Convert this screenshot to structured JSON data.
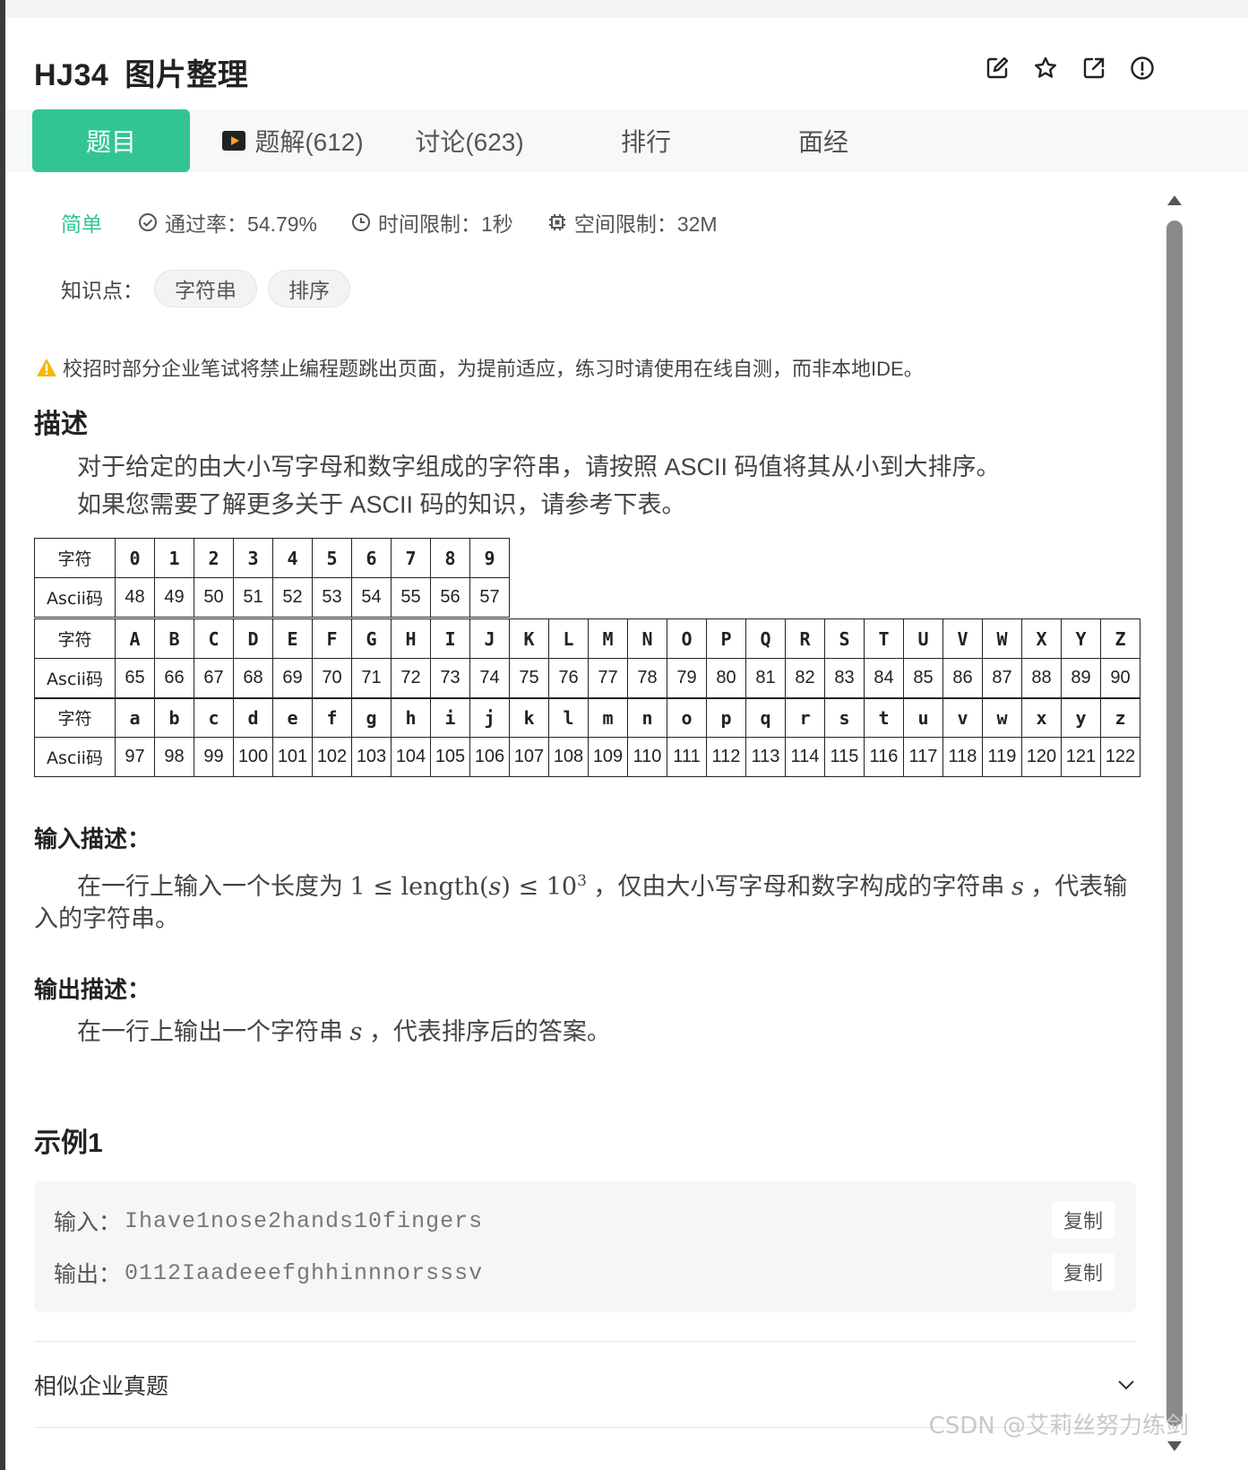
{
  "problem": {
    "id": "HJ34",
    "title": "图片整理"
  },
  "tabs": [
    {
      "label": "题目"
    },
    {
      "label": "题解(612)"
    },
    {
      "label": "讨论(623)"
    },
    {
      "label": "排行"
    },
    {
      "label": "面经"
    }
  ],
  "meta": {
    "level": "简单",
    "pass_rate": "通过率：54.79%",
    "time_limit": "时间限制：1秒",
    "space_limit": "空间限制：32M"
  },
  "knowledge": {
    "label": "知识点：",
    "tags": [
      "字符串",
      "排序"
    ]
  },
  "warning": "校招时部分企业笔试将禁止编程题跳出页面，为提前适应，练习时请使用在线自测，而非本地IDE。",
  "description": {
    "heading": "描述",
    "line1": "对于给定的由大小写字母和数字组成的字符串，请按照 ASCII 码值将其从小到大排序。",
    "line2": "如果您需要了解更多关于 ASCII 码的知识，请参考下表。"
  },
  "ascii_table": {
    "char_label": "字符",
    "code_label": "Ascii码",
    "digits": {
      "chars": [
        "0",
        "1",
        "2",
        "3",
        "4",
        "5",
        "6",
        "7",
        "8",
        "9"
      ],
      "codes": [
        "48",
        "49",
        "50",
        "51",
        "52",
        "53",
        "54",
        "55",
        "56",
        "57"
      ]
    },
    "upper": {
      "chars": [
        "A",
        "B",
        "C",
        "D",
        "E",
        "F",
        "G",
        "H",
        "I",
        "J",
        "K",
        "L",
        "M",
        "N",
        "O",
        "P",
        "Q",
        "R",
        "S",
        "T",
        "U",
        "V",
        "W",
        "X",
        "Y",
        "Z"
      ],
      "codes": [
        "65",
        "66",
        "67",
        "68",
        "69",
        "70",
        "71",
        "72",
        "73",
        "74",
        "75",
        "76",
        "77",
        "78",
        "79",
        "80",
        "81",
        "82",
        "83",
        "84",
        "85",
        "86",
        "87",
        "88",
        "89",
        "90"
      ]
    },
    "lower": {
      "chars": [
        "a",
        "b",
        "c",
        "d",
        "e",
        "f",
        "g",
        "h",
        "i",
        "j",
        "k",
        "l",
        "m",
        "n",
        "o",
        "p",
        "q",
        "r",
        "s",
        "t",
        "u",
        "v",
        "w",
        "x",
        "y",
        "z"
      ],
      "codes": [
        "97",
        "98",
        "99",
        "100",
        "101",
        "102",
        "103",
        "104",
        "105",
        "106",
        "107",
        "108",
        "109",
        "110",
        "111",
        "112",
        "113",
        "114",
        "115",
        "116",
        "117",
        "118",
        "119",
        "120",
        "121",
        "122"
      ]
    }
  },
  "input_desc": {
    "heading": "输入描述：",
    "text_before": "在一行上输入一个长度为 ",
    "math": "1 ≤ length(",
    "math_var": "s",
    "math_after": ") ≤ 10",
    "math_sup": "3",
    "text_mid": " ，仅由大小写字母和数字构成的字符串 ",
    "var": "s",
    "text_after": " ，代表输",
    "line2": "入的字符串。"
  },
  "output_desc": {
    "heading": "输出描述：",
    "text_before": "在一行上输出一个字符串 ",
    "var": "s",
    "text_after": " ，代表排序后的答案。"
  },
  "example": {
    "heading": "示例1",
    "input_label": "输入：",
    "input_value": "Ihave1nose2hands10fingers",
    "output_label": "输出：",
    "output_value": "0112Iaadeeefghhinnnorsssv",
    "copy_label": "复制"
  },
  "similar": {
    "label": "相似企业真题"
  },
  "watermark": "CSDN @艾莉丝努力练剑",
  "colors": {
    "accent": "#32c593",
    "warning": "#f5b700"
  }
}
